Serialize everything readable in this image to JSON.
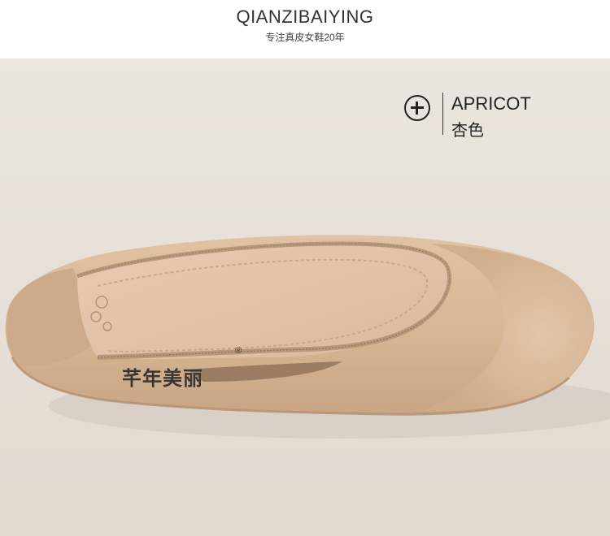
{
  "header": {
    "brand": "QIANZIBAIYING",
    "tagline": "专注真皮女鞋20年"
  },
  "color_tag": {
    "icon": "plus-circle-icon",
    "name_en": "APRICOT",
    "name_cn": "杏色"
  },
  "product": {
    "insole_brand": "芊年美丽",
    "insole_mark": "®"
  },
  "colors": {
    "background": "#e6e0d8",
    "leather": "#d8b99a",
    "insole": "#e7c9b1",
    "text": "#222222"
  }
}
